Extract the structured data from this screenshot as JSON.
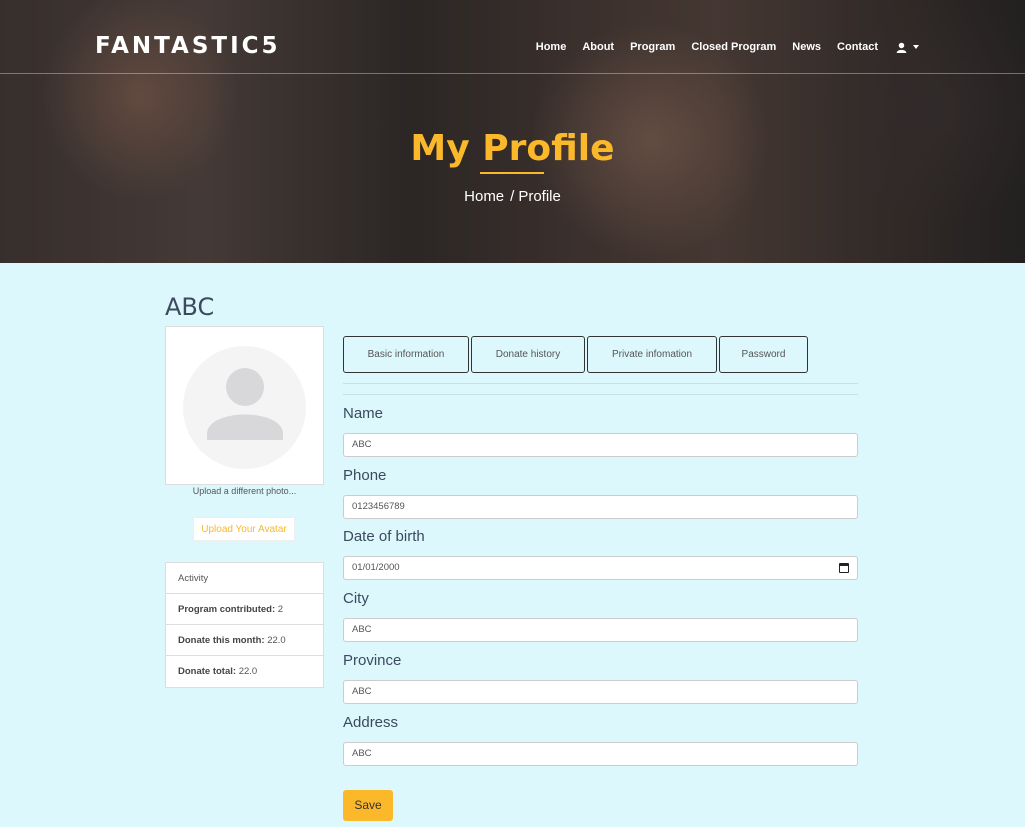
{
  "brand": "FANTASTIC5",
  "nav": {
    "items": [
      "Home",
      "About",
      "Program",
      "Closed Program",
      "News",
      "Contact"
    ]
  },
  "hero": {
    "title": "My Profile",
    "breadcrumb_home": "Home",
    "breadcrumb_sep": "/",
    "breadcrumb_current": "Profile"
  },
  "profile": {
    "name": "ABC",
    "upload_text": "Upload a different photo...",
    "upload_button": "Upload Your Avatar"
  },
  "activity": {
    "header": "Activity",
    "rows": [
      {
        "label": "Program contributed:",
        "value": "2"
      },
      {
        "label": "Donate this month:",
        "value": "22.0"
      },
      {
        "label": "Donate total:",
        "value": "22.0"
      }
    ]
  },
  "tabs": [
    "Basic information",
    "Donate history",
    "Private infomation",
    "Password"
  ],
  "form": {
    "fields": [
      {
        "label": "Name",
        "value": "ABC"
      },
      {
        "label": "Phone",
        "value": "0123456789"
      },
      {
        "label": "Date of birth",
        "value": "01/01/2000"
      },
      {
        "label": "City",
        "value": "ABC"
      },
      {
        "label": "Province",
        "value": "ABC"
      },
      {
        "label": "Address",
        "value": "ABC"
      }
    ],
    "save_label": "Save"
  },
  "colors": {
    "accent": "#fbb82b",
    "page_background": "#dcf8fc"
  }
}
